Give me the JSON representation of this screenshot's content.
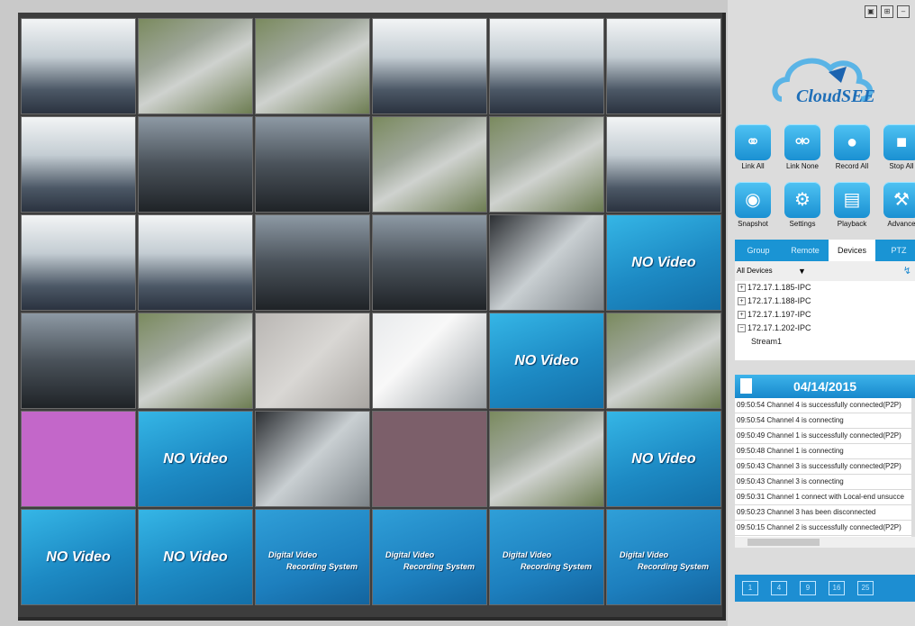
{
  "window_icons": [
    "restore-icon",
    "layout-icon",
    "minimize-icon"
  ],
  "logo": {
    "text": "CloudSEE",
    "mark": "®"
  },
  "toolbar_row1": [
    {
      "label": "Link All",
      "icon": "link-icon"
    },
    {
      "label": "Link None",
      "icon": "unlink-icon"
    },
    {
      "label": "Record All",
      "icon": "record-icon"
    },
    {
      "label": "Stop All",
      "icon": "stop-record-icon"
    }
  ],
  "toolbar_row2": [
    {
      "label": "Snapshot",
      "icon": "snapshot-icon"
    },
    {
      "label": "Settings",
      "icon": "gear-icon"
    },
    {
      "label": "Playback",
      "icon": "playback-icon"
    },
    {
      "label": "Advance",
      "icon": "advanced-icon"
    }
  ],
  "tabs": [
    "Group",
    "Remote",
    "Devices",
    "PTZ"
  ],
  "devices": {
    "filter": "All Devices",
    "items": [
      "172.17.1.185-IPC",
      "172.17.1.188-IPC",
      "172.17.1.197-IPC",
      "172.17.1.202-IPC"
    ],
    "child": "Stream1"
  },
  "log": {
    "date": "04/14/2015",
    "rows": [
      "09:50:54 Channel 4 is successfully connected(P2P)",
      "09:50:54 Channel 4 is connecting",
      "09:50:49 Channel 1 is successfully connected(P2P)",
      "09:50:48 Channel 1 is connecting",
      "09:50:43 Channel 3 is successfully connected(P2P)",
      "09:50:43 Channel 3 is connecting",
      "09:50:31 Channel 1 connect with Local-end unsucce",
      "09:50:23 Channel 3 has been disconnected",
      "09:50:15 Channel 2 is successfully connected(P2P)"
    ]
  },
  "video_wall": {
    "no_video": "NO Video",
    "dvrs_line1": "Digital Video",
    "dvrs_line2": "Recording System",
    "cells": [
      "cam:office",
      "cam:road",
      "cam:road",
      "cam:office",
      "cam:office",
      "cam:office",
      "cam:office",
      "cam:dark",
      "cam:dark",
      "cam:road",
      "cam:road",
      "cam:office",
      "cam:office",
      "cam:office",
      "cam:dark",
      "cam:dark",
      "cam:close",
      "nv",
      "cam:dark",
      "cam:road",
      "cam:ceiling",
      "cam:white",
      "nv",
      "cam:road",
      "cam:pink",
      "nv",
      "cam:close",
      "cam:mauve",
      "cam:road",
      "nv",
      "nv",
      "nv",
      "dv",
      "dv",
      "dv",
      "dv"
    ]
  },
  "layouts": [
    "1",
    "4",
    "9",
    "16",
    "25"
  ]
}
